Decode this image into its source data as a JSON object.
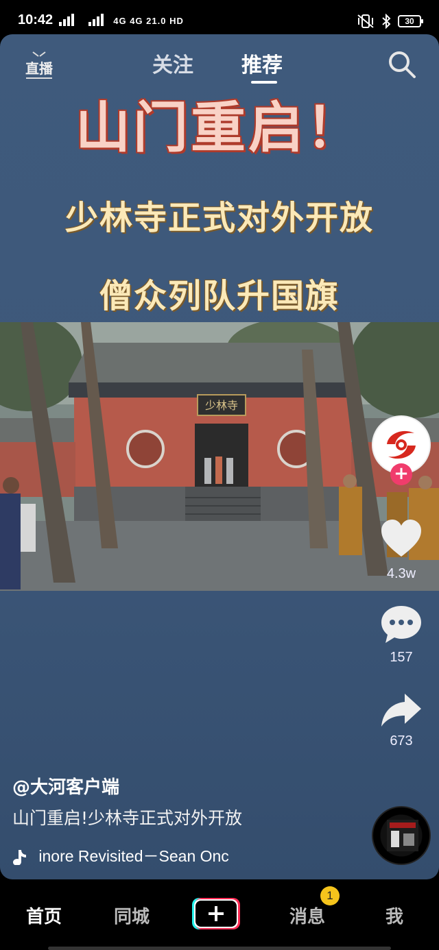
{
  "status_bar": {
    "time": "10:42",
    "network": "4G 4G 21.0 HD",
    "battery": "30"
  },
  "top_nav": {
    "live_label": "直播",
    "tab_follow": "关注",
    "tab_recommend": "推荐"
  },
  "video": {
    "headline_1": "山门重启！",
    "headline_2": "少林寺正式对外开放",
    "headline_3": "僧众列队升国旗",
    "temple_plaque": "少林寺"
  },
  "right_rail": {
    "like_count": "4.3w",
    "comment_count": "157",
    "share_count": "673"
  },
  "post": {
    "author": "@大河客户端",
    "caption": "山门重启!少林寺正式对外开放",
    "music": "inore Revisited－Sean Onc"
  },
  "bottom_bar": {
    "home": "首页",
    "city": "同城",
    "messages": "消息",
    "messages_badge": "1",
    "me": "我"
  },
  "colors": {
    "video_bg": "#3f5a7c",
    "headline_red": "#b13b2c",
    "headline_gold": "#fbe9b8",
    "follow_plus": "#f03c6c",
    "badge": "#f5c41c"
  }
}
